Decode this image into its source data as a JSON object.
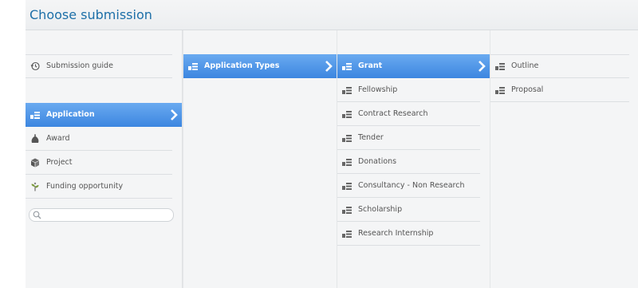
{
  "header": {
    "title": "Choose submission"
  },
  "col1": {
    "guide": "Submission guide",
    "items": [
      "Application",
      "Award",
      "Project",
      "Funding opportunity"
    ],
    "search_placeholder": ""
  },
  "col2": {
    "items": [
      "Application Types"
    ]
  },
  "col3": {
    "items": [
      "Grant",
      "Fellowship",
      "Contract Research",
      "Tender",
      "Donations",
      "Consultancy - Non Research",
      "Scholarship",
      "Research Internship"
    ]
  },
  "col4": {
    "items": [
      "Outline",
      "Proposal"
    ]
  },
  "colors": {
    "accent": "#3c86e0",
    "title": "#1d6fa8",
    "panel": "#f4f5f6"
  },
  "icons": {
    "guide": "history-clock-icon",
    "type": "form-list-icon",
    "award": "bag-icon",
    "project": "cube-icon",
    "funding": "sprout-icon",
    "search": "search-icon"
  }
}
